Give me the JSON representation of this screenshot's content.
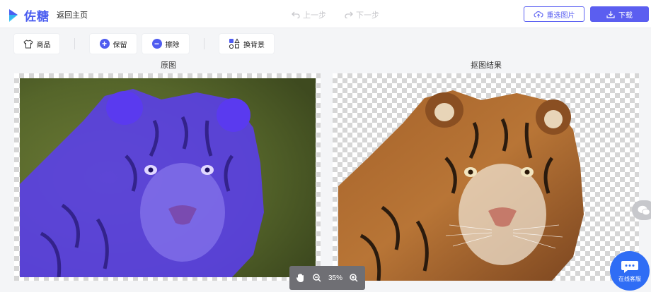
{
  "header": {
    "logo_text": "佐糖",
    "back_label": "返回主页",
    "undo_label": "上一步",
    "redo_label": "下一步",
    "reselect_label": "重选图片",
    "download_label": "下载"
  },
  "toolbar": {
    "goods_label": "商品",
    "keep_label": "保留",
    "erase_label": "擦除",
    "change_bg_label": "换背景"
  },
  "panels": {
    "original_label": "原图",
    "result_label": "抠图结果"
  },
  "zoom": {
    "level": "35%"
  },
  "float": {
    "service_label": "在线客服"
  },
  "colors": {
    "accent": "#5b5ef0",
    "overlay": "#5a3cf0",
    "service": "#2f6df5"
  },
  "icons": {
    "goods": "shirt-icon",
    "keep": "plus-circle-icon",
    "erase": "minus-circle-icon",
    "change_bg": "shapes-icon",
    "reselect": "upload-cloud-icon",
    "download": "download-icon",
    "hand": "hand-icon",
    "zoom_out": "zoom-out-icon",
    "zoom_in": "zoom-in-icon"
  }
}
